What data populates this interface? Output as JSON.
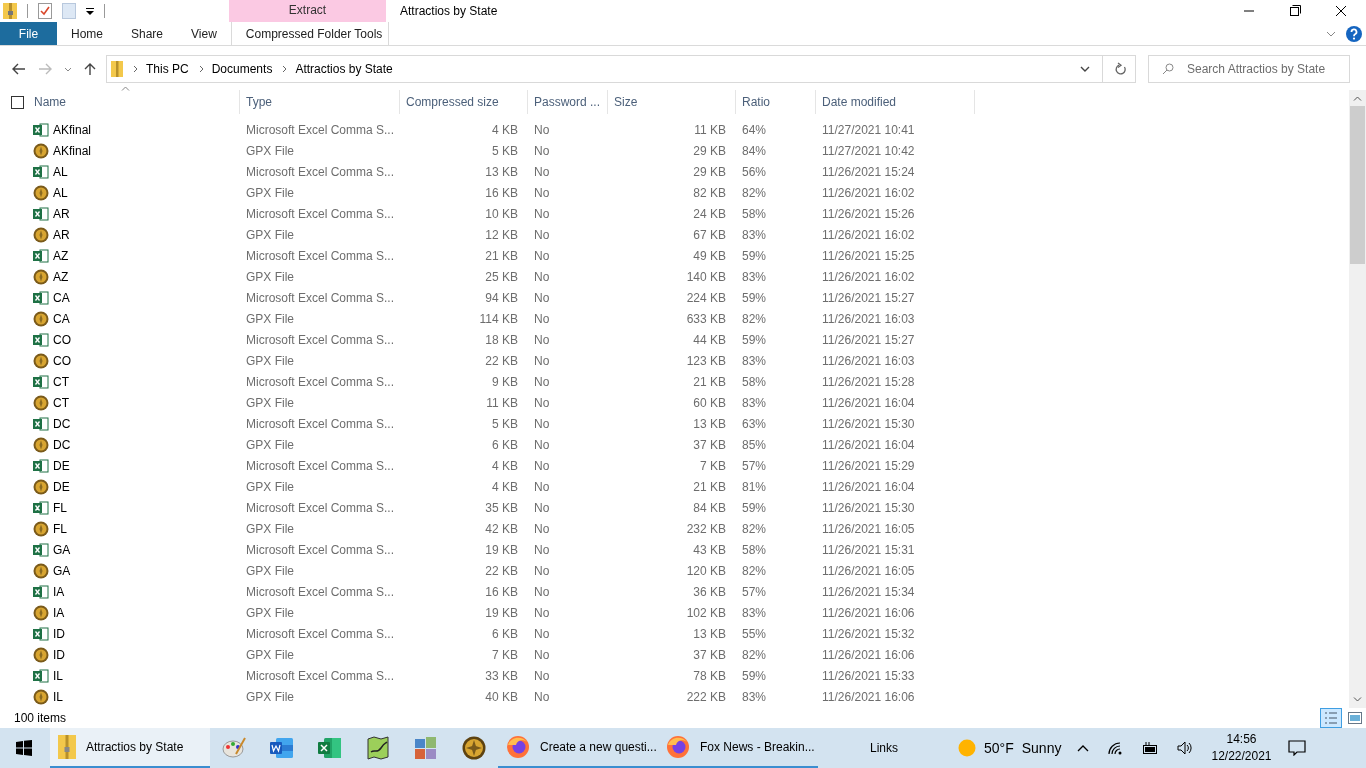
{
  "window": {
    "title": "Attractios by State"
  },
  "context_tab": {
    "group": "Extract",
    "label": "Compressed Folder Tools"
  },
  "ribbon_tabs": [
    {
      "label": "File",
      "selected": true
    },
    {
      "label": "Home",
      "selected": false
    },
    {
      "label": "Share",
      "selected": false
    },
    {
      "label": "View",
      "selected": false
    }
  ],
  "breadcrumb": [
    "This PC",
    "Documents",
    "Attractios by State"
  ],
  "search": {
    "placeholder": "Search Attractios by State"
  },
  "select_all": {
    "checked": false
  },
  "columns": [
    {
      "label": "Name"
    },
    {
      "label": "Type"
    },
    {
      "label": "Compressed size"
    },
    {
      "label": "Password ..."
    },
    {
      "label": "Size"
    },
    {
      "label": "Ratio"
    },
    {
      "label": "Date modified"
    }
  ],
  "rows": [
    {
      "kind": "csv",
      "name": "AKfinal",
      "type": "Microsoft Excel Comma S...",
      "compressed": "4 KB",
      "password": "No",
      "size": "11 KB",
      "ratio": "64%",
      "date": "11/27/2021 10:41"
    },
    {
      "kind": "gpx",
      "name": "AKfinal",
      "type": "GPX File",
      "compressed": "5 KB",
      "password": "No",
      "size": "29 KB",
      "ratio": "84%",
      "date": "11/27/2021 10:42"
    },
    {
      "kind": "csv",
      "name": "AL",
      "type": "Microsoft Excel Comma S...",
      "compressed": "13 KB",
      "password": "No",
      "size": "29 KB",
      "ratio": "56%",
      "date": "11/26/2021 15:24"
    },
    {
      "kind": "gpx",
      "name": "AL",
      "type": "GPX File",
      "compressed": "16 KB",
      "password": "No",
      "size": "82 KB",
      "ratio": "82%",
      "date": "11/26/2021 16:02"
    },
    {
      "kind": "csv",
      "name": "AR",
      "type": "Microsoft Excel Comma S...",
      "compressed": "10 KB",
      "password": "No",
      "size": "24 KB",
      "ratio": "58%",
      "date": "11/26/2021 15:26"
    },
    {
      "kind": "gpx",
      "name": "AR",
      "type": "GPX File",
      "compressed": "12 KB",
      "password": "No",
      "size": "67 KB",
      "ratio": "83%",
      "date": "11/26/2021 16:02"
    },
    {
      "kind": "csv",
      "name": "AZ",
      "type": "Microsoft Excel Comma S...",
      "compressed": "21 KB",
      "password": "No",
      "size": "49 KB",
      "ratio": "59%",
      "date": "11/26/2021 15:25"
    },
    {
      "kind": "gpx",
      "name": "AZ",
      "type": "GPX File",
      "compressed": "25 KB",
      "password": "No",
      "size": "140 KB",
      "ratio": "83%",
      "date": "11/26/2021 16:02"
    },
    {
      "kind": "csv",
      "name": "CA",
      "type": "Microsoft Excel Comma S...",
      "compressed": "94 KB",
      "password": "No",
      "size": "224 KB",
      "ratio": "59%",
      "date": "11/26/2021 15:27"
    },
    {
      "kind": "gpx",
      "name": "CA",
      "type": "GPX File",
      "compressed": "114 KB",
      "password": "No",
      "size": "633 KB",
      "ratio": "82%",
      "date": "11/26/2021 16:03"
    },
    {
      "kind": "csv",
      "name": "CO",
      "type": "Microsoft Excel Comma S...",
      "compressed": "18 KB",
      "password": "No",
      "size": "44 KB",
      "ratio": "59%",
      "date": "11/26/2021 15:27"
    },
    {
      "kind": "gpx",
      "name": "CO",
      "type": "GPX File",
      "compressed": "22 KB",
      "password": "No",
      "size": "123 KB",
      "ratio": "83%",
      "date": "11/26/2021 16:03"
    },
    {
      "kind": "csv",
      "name": "CT",
      "type": "Microsoft Excel Comma S...",
      "compressed": "9 KB",
      "password": "No",
      "size": "21 KB",
      "ratio": "58%",
      "date": "11/26/2021 15:28"
    },
    {
      "kind": "gpx",
      "name": "CT",
      "type": "GPX File",
      "compressed": "11 KB",
      "password": "No",
      "size": "60 KB",
      "ratio": "83%",
      "date": "11/26/2021 16:04"
    },
    {
      "kind": "csv",
      "name": "DC",
      "type": "Microsoft Excel Comma S...",
      "compressed": "5 KB",
      "password": "No",
      "size": "13 KB",
      "ratio": "63%",
      "date": "11/26/2021 15:30"
    },
    {
      "kind": "gpx",
      "name": "DC",
      "type": "GPX File",
      "compressed": "6 KB",
      "password": "No",
      "size": "37 KB",
      "ratio": "85%",
      "date": "11/26/2021 16:04"
    },
    {
      "kind": "csv",
      "name": "DE",
      "type": "Microsoft Excel Comma S...",
      "compressed": "4 KB",
      "password": "No",
      "size": "7 KB",
      "ratio": "57%",
      "date": "11/26/2021 15:29"
    },
    {
      "kind": "gpx",
      "name": "DE",
      "type": "GPX File",
      "compressed": "4 KB",
      "password": "No",
      "size": "21 KB",
      "ratio": "81%",
      "date": "11/26/2021 16:04"
    },
    {
      "kind": "csv",
      "name": "FL",
      "type": "Microsoft Excel Comma S...",
      "compressed": "35 KB",
      "password": "No",
      "size": "84 KB",
      "ratio": "59%",
      "date": "11/26/2021 15:30"
    },
    {
      "kind": "gpx",
      "name": "FL",
      "type": "GPX File",
      "compressed": "42 KB",
      "password": "No",
      "size": "232 KB",
      "ratio": "82%",
      "date": "11/26/2021 16:05"
    },
    {
      "kind": "csv",
      "name": "GA",
      "type": "Microsoft Excel Comma S...",
      "compressed": "19 KB",
      "password": "No",
      "size": "43 KB",
      "ratio": "58%",
      "date": "11/26/2021 15:31"
    },
    {
      "kind": "gpx",
      "name": "GA",
      "type": "GPX File",
      "compressed": "22 KB",
      "password": "No",
      "size": "120 KB",
      "ratio": "82%",
      "date": "11/26/2021 16:05"
    },
    {
      "kind": "csv",
      "name": "IA",
      "type": "Microsoft Excel Comma S...",
      "compressed": "16 KB",
      "password": "No",
      "size": "36 KB",
      "ratio": "57%",
      "date": "11/26/2021 15:34"
    },
    {
      "kind": "gpx",
      "name": "IA",
      "type": "GPX File",
      "compressed": "19 KB",
      "password": "No",
      "size": "102 KB",
      "ratio": "83%",
      "date": "11/26/2021 16:06"
    },
    {
      "kind": "csv",
      "name": "ID",
      "type": "Microsoft Excel Comma S...",
      "compressed": "6 KB",
      "password": "No",
      "size": "13 KB",
      "ratio": "55%",
      "date": "11/26/2021 15:32"
    },
    {
      "kind": "gpx",
      "name": "ID",
      "type": "GPX File",
      "compressed": "7 KB",
      "password": "No",
      "size": "37 KB",
      "ratio": "82%",
      "date": "11/26/2021 16:06"
    },
    {
      "kind": "csv",
      "name": "IL",
      "type": "Microsoft Excel Comma S...",
      "compressed": "33 KB",
      "password": "No",
      "size": "78 KB",
      "ratio": "59%",
      "date": "11/26/2021 15:33"
    },
    {
      "kind": "gpx",
      "name": "IL",
      "type": "GPX File",
      "compressed": "40 KB",
      "password": "No",
      "size": "222 KB",
      "ratio": "83%",
      "date": "11/26/2021 16:06"
    }
  ],
  "status_bar": {
    "count": "100 items"
  },
  "taskbar": {
    "apps": [
      {
        "kind": "explorer",
        "label": "Attractios by State",
        "selected": true,
        "open": true
      },
      {
        "kind": "paint",
        "selected": false,
        "open": false
      },
      {
        "kind": "word",
        "selected": false,
        "open": false
      },
      {
        "kind": "excel",
        "selected": false,
        "open": false
      },
      {
        "kind": "map",
        "selected": false,
        "open": false
      },
      {
        "kind": "tiles",
        "selected": false,
        "open": false
      },
      {
        "kind": "gpx",
        "selected": false,
        "open": false
      },
      {
        "kind": "firefox",
        "label": "Create a new questi...",
        "selected": false,
        "open": true
      },
      {
        "kind": "firefox",
        "label": "Fox News - Breakin...",
        "selected": false,
        "open": true
      }
    ],
    "links": "Links",
    "temperature": "50°F",
    "weather": "Sunny",
    "time": "14:56",
    "date": "12/22/2021"
  }
}
